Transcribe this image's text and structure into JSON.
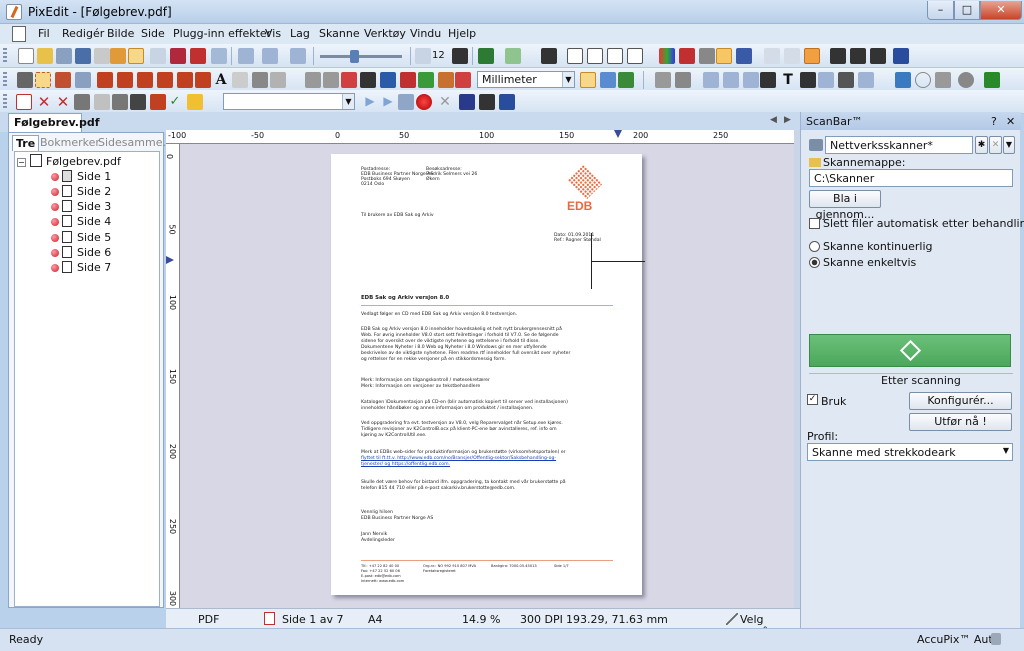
{
  "window": {
    "title": "PixEdit - [Følgebrev.pdf]",
    "min": "–",
    "max": "□",
    "close": "✕"
  },
  "menu": [
    "Fil",
    "Redigér",
    "Bilde",
    "Side",
    "Plugg-inn effekter",
    "Vis",
    "Lag",
    "Skanne",
    "Verktøy",
    "Vindu",
    "Hjelp"
  ],
  "toolbar": {
    "page_number": "12",
    "unit": "Millimeter"
  },
  "doc": {
    "tab": "Følgebrev.pdf",
    "panel_tabs": [
      "Tre",
      "Bokmerker",
      "Sidesamme..."
    ],
    "root": "Følgebrev.pdf",
    "pages": [
      "Side 1",
      "Side 2",
      "Side 3",
      "Side 4",
      "Side 5",
      "Side 6",
      "Side 7"
    ]
  },
  "ruler": {
    "h": [
      "-100",
      "-50",
      "0",
      "50",
      "100",
      "150",
      "200",
      "250"
    ],
    "v": [
      "0",
      "50",
      "100",
      "150",
      "200",
      "250",
      "300"
    ]
  },
  "letter": {
    "sender_label": "Postadresse:",
    "sender_1": "EDB Business Partner Norge AS",
    "sender_2": "Postboks 694 Skøyen",
    "sender_3": "0214 Oslo",
    "visit_label": "Besøksadresse:",
    "visit_1": "Fredrik Selmers vei 26",
    "visit_2": "Økern",
    "logo": "EDB",
    "recipient": "Til brukere av EDB Sak og Arkiv",
    "date": "Dato: 01.09.2011",
    "ref": "Ref.: Rogner Støndal",
    "heading": "EDB Sak og Arkiv versjon 8.0",
    "p1": "Vedlagt følger en CD med EDB Sak og Arkiv versjon 8.0 testversjon.",
    "p2": [
      "EDB Sak og Arkiv versjon 8.0 inneholder hovedsakelig et helt nytt brukergrensesnitt på",
      "Web. For øvrig inneholder V8.0 stort sett feilrettinger i forhold til V7.0. Se de følgende",
      "sidene for oversikt over de viktigste nyhetene og rettelsene i forhold til disse.",
      "Dokumentene Nyheter i 8.0 Web og Nyheter i 8.0 Windows gir en mer utfyllende",
      "beskrivelse av de viktigste nyhetene. Filen readme.rtf inneholder full oversikt over nyheter",
      "og rettelser for en rekke versjoner på en stikkordsmessig form."
    ],
    "p3": [
      "Merk: Informasjon om tilgangskontroll / møtesekretærer",
      "Merk: Informasjon om versjoner av tekstbehandlere"
    ],
    "p4": [
      "Katalogen \\Dokumentasjon på CD-en (blir automatisk kopiert til server ved installasjonen)",
      "inneholder håndbøker og annen informasjon om produktet / installasjonen."
    ],
    "p5": [
      "Ved oppgradering fra evt. testversjon av V8.0, velg Reparervalget når Setup.exe kjøres.",
      "Tidligere revisjoner av K2ControlB.ocx på klient-PC-ene bør avinstalleres, ref. info om",
      "kjøring av K2ControlUtil.exe."
    ],
    "p6": [
      "Merk at EDBs web-sider for produktinformasjon og brukerstøtte (virksomhetsportalen) er",
      "flyttet til ft.tt.v. http://www.edb.com/no/Bransjer/Offentlig-sektor/Saksbehandling-og-",
      "tjenester/ og https://offentlig.edb.com."
    ],
    "p7": [
      "Skulle det være behov for bistand ifm. oppgradering, ta kontakt med vår brukerstøtte på",
      "telefon 815 44 710 eller på e-post sakarkiv.brukerstotte@edb.com."
    ],
    "closing": "Vennlig hilsen",
    "company": "EDB Business Partner Norge AS",
    "signer": "Jann Nervik",
    "title": "Avdelingsleder",
    "footer": [
      "Tlf.: +47 22 82 40 00",
      "Fax: +47 22 52 60 06",
      "E-post: edb@edb.com",
      "Internett: www.edb.com",
      "Org.nr.: NO 992 910 807 MVA",
      "Foretaksregisteret",
      "Bankgiro: 7000.05.45013",
      "Side 1/7"
    ]
  },
  "docstatus": {
    "format": "PDF",
    "page": "Side 1 av 7",
    "size": "A4",
    "zoom": "14.9 %",
    "dpi": "300 DPI",
    "coords": "193.29, 71.63 mm",
    "mode": "Velg område"
  },
  "status": {
    "left": "Ready",
    "right": "AccuPix™ Auto"
  },
  "scanbar": {
    "title": "ScanBar™",
    "help": "?",
    "close": "✕",
    "scanner": "Nettverksskanner*",
    "folder_label": "Skannemappe:",
    "folder": "C:\\Skanner",
    "browse": "Bla i gjennom...",
    "delete_files": "Slett filer automatisk etter behandling",
    "continuous": "Skanne kontinuerlig",
    "single": "Skanne enkeltvis",
    "after_scan": "Etter scanning",
    "use": "Bruk",
    "configure": "Konfigurér...",
    "run_now": "Utfør nå !",
    "profile_label": "Profil:",
    "profile": "Skanne med strekkodeark"
  }
}
